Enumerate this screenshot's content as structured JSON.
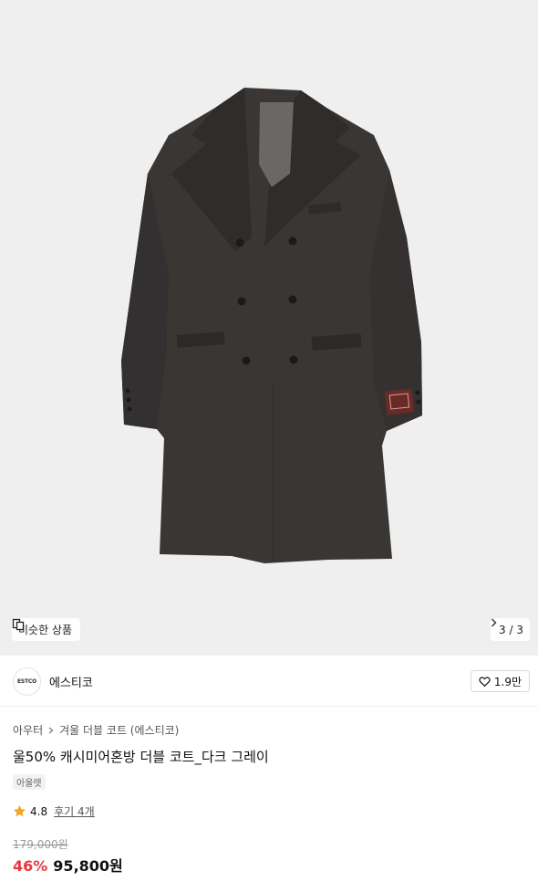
{
  "hero": {
    "image_alt": "coat-image",
    "similar_label": "비슷한 상품",
    "page_counter": "3 / 3"
  },
  "brand": {
    "logo_text": "ESTCO",
    "name": "에스티코",
    "likes": "1.9만"
  },
  "product": {
    "breadcrumb": [
      "아우터",
      "겨울 더블 코트 (에스티코)"
    ],
    "title": "울50% 캐시미어혼방 더블 코트_다크 그레이",
    "tag": "아울렛",
    "rating": "4.8",
    "reviews": "후기 4개",
    "original_price": "179,000원",
    "discount": "46%",
    "price": "95,800원"
  },
  "colors": {
    "accent_red": "#e8363d",
    "star": "#f5a623",
    "coat": "#3a3735"
  }
}
